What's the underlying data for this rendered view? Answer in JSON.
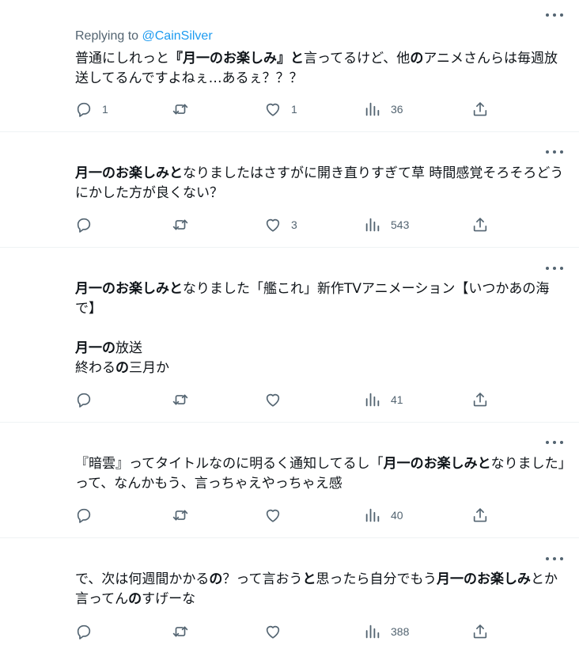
{
  "tweets": [
    {
      "replying_to_label": "Replying to",
      "replying_to_handle": "@CainSilver",
      "text_segments": [
        {
          "t": "普通にしれっと",
          "b": false
        },
        {
          "t": "『月一のお楽しみ』と",
          "b": true
        },
        {
          "t": "言ってるけど、他",
          "b": false
        },
        {
          "t": "の",
          "b": true
        },
        {
          "t": "アニメさんらは毎週放送してるんですよねぇ…あるぇ？？？",
          "b": false
        }
      ],
      "reply_count": "1",
      "retweet_count": "",
      "like_count": "1",
      "view_count": "36"
    },
    {
      "text_segments": [
        {
          "t": "月一のお楽しみと",
          "b": true
        },
        {
          "t": "なりましたはさすがに開き直りすぎて草 時間感覚そろそろどうにかした方が良くない？",
          "b": false
        }
      ],
      "reply_count": "",
      "retweet_count": "",
      "like_count": "3",
      "view_count": "543"
    },
    {
      "text_segments": [
        {
          "t": "月一のお楽しみと",
          "b": true
        },
        {
          "t": "なりました「艦これ」新作TVアニメーション【いつかあの海で】\n\n",
          "b": false
        },
        {
          "t": "月一の",
          "b": true
        },
        {
          "t": "放送\n終わる",
          "b": false
        },
        {
          "t": "の",
          "b": true
        },
        {
          "t": "三月か",
          "b": false
        }
      ],
      "reply_count": "",
      "retweet_count": "",
      "like_count": "",
      "view_count": "41"
    },
    {
      "text_segments": [
        {
          "t": "『暗雲』ってタイトルなのに明るく通知してるし「",
          "b": false
        },
        {
          "t": "月一のお楽しみと",
          "b": true
        },
        {
          "t": "なりました」って、なんかもう、言っちゃえやっちゃえ感",
          "b": false
        }
      ],
      "reply_count": "",
      "retweet_count": "",
      "like_count": "",
      "view_count": "40"
    },
    {
      "text_segments": [
        {
          "t": "で、次は何週間かかる",
          "b": false
        },
        {
          "t": "の",
          "b": true
        },
        {
          "t": "？って言おう",
          "b": false
        },
        {
          "t": "と",
          "b": true
        },
        {
          "t": "思ったら自分でもう",
          "b": false
        },
        {
          "t": "月一のお楽しみ",
          "b": true
        },
        {
          "t": "とか言ってん",
          "b": false
        },
        {
          "t": "の",
          "b": true
        },
        {
          "t": "すげーな",
          "b": false
        }
      ],
      "reply_count": "",
      "retweet_count": "",
      "like_count": "",
      "view_count": "388"
    }
  ],
  "icons": {
    "reply": "reply-icon",
    "retweet": "retweet-icon",
    "like": "heart-icon",
    "views": "views-icon",
    "share": "share-icon",
    "more": "more-icon"
  },
  "colors": {
    "text": "#0f1419",
    "secondary": "#536471",
    "link": "#1d9bf0",
    "divider": "#eff3f4"
  }
}
